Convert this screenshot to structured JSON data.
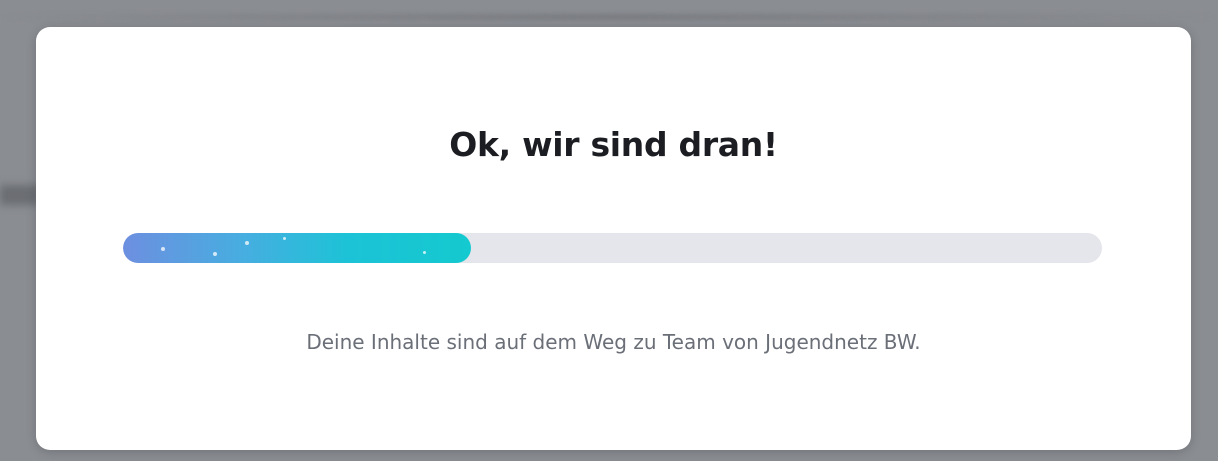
{
  "dialog": {
    "title": "Ok, wir sind dran!",
    "message": "Deine Inhalte sind auf dem Weg zu Team von Jugendnetz BW.",
    "progress_fraction": 0.355
  },
  "colors": {
    "backdrop": "#8a8d92",
    "modal_background": "#ffffff",
    "title_text": "#1b1d22",
    "message_text": "#6b6f78",
    "progress_track": "#e4e6eb",
    "progress_gradient_start": "#6d8fe0",
    "progress_gradient_end": "#14c9cf"
  }
}
